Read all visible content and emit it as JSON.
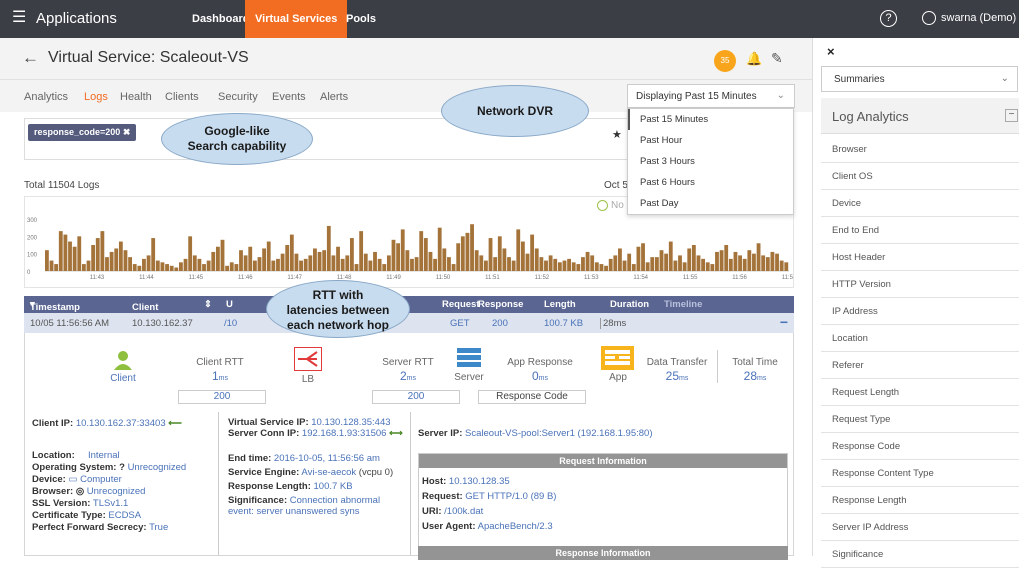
{
  "topbar": {
    "menu_icon": "hamburger-icon",
    "app_title": "Applications",
    "tabs": [
      "Dashboard",
      "Virtual Services",
      "Pools"
    ],
    "active_tab": "Virtual Services",
    "help": "?",
    "user": "swarna (Demo)"
  },
  "header": {
    "back": "←",
    "title": "Virtual Service: Scaleout-VS",
    "badge": "35"
  },
  "tabs": [
    "Analytics",
    "Logs",
    "Health",
    "Clients",
    "Security",
    "Events",
    "Alerts"
  ],
  "active_tab": "Logs",
  "search": {
    "chip": "response_code=200"
  },
  "time": {
    "selected": "Displaying Past 15 Minutes",
    "options": [
      "Past 15 Minutes",
      "Past Hour",
      "Past 3 Hours",
      "Past 6 Hours",
      "Past Day"
    ]
  },
  "stats": {
    "total": "Total 11504 Logs",
    "date": "Oct 5",
    "no_label": "No"
  },
  "chart_data": {
    "type": "bar",
    "y_ticks": [
      "300",
      "200",
      "100",
      "0"
    ],
    "x_ticks": [
      "11:43",
      "11:44",
      "11:45",
      "11:46",
      "11:47",
      "11:48",
      "11:49",
      "11:50",
      "11:51",
      "11:52",
      "11:53",
      "11:54",
      "11:55",
      "11:56",
      "11:57"
    ],
    "ylim": [
      0,
      300
    ],
    "values": [
      120,
      60,
      40,
      230,
      210,
      170,
      140,
      200,
      40,
      60,
      150,
      190,
      230,
      80,
      110,
      130,
      170,
      120,
      80,
      40,
      30,
      70,
      90,
      190,
      60,
      50,
      40,
      30,
      20,
      50,
      70,
      200,
      90,
      70,
      40,
      60,
      110,
      140,
      180,
      30,
      50,
      40,
      120,
      90,
      140,
      60,
      80,
      130,
      170,
      60,
      70,
      100,
      150,
      210,
      100,
      60,
      70,
      90,
      130,
      110,
      120,
      260,
      90,
      140,
      70,
      90,
      190,
      40,
      230,
      100,
      60,
      110,
      70,
      40,
      90,
      180,
      160,
      240,
      120,
      70,
      80,
      230,
      190,
      110,
      70,
      250,
      130,
      80,
      40,
      160,
      200,
      220,
      270,
      120,
      90,
      60,
      190,
      80,
      200,
      130,
      80,
      60,
      240,
      170,
      100,
      210,
      130,
      80,
      60,
      90,
      70,
      50,
      60,
      70,
      50,
      40,
      80,
      110,
      90,
      50,
      40,
      30,
      70,
      90,
      130,
      60,
      100,
      40,
      140,
      160,
      50,
      80,
      80,
      120,
      100,
      170,
      60,
      90,
      50,
      130,
      150,
      90,
      70,
      50,
      40,
      110,
      120,
      150,
      70,
      110,
      90,
      70,
      120,
      100,
      160,
      90,
      80,
      110,
      100,
      60,
      50
    ]
  },
  "table": {
    "headers": [
      "Timestamp",
      "Client IP",
      "U",
      "Request",
      "Response",
      "Length",
      "Duration",
      "Timeline"
    ],
    "row": {
      "timestamp": "10/05 11:56:56 AM",
      "client_ip": "10.130.162.37",
      "uri": "/10",
      "request": "GET",
      "response": "200",
      "length": "100.7 KB",
      "duration": "28ms"
    }
  },
  "flow": {
    "client": "Client",
    "client_rtt_label": "Client RTT",
    "client_rtt": "1",
    "lb": "LB",
    "server_rtt_label": "Server RTT",
    "server_rtt": "2",
    "server": "Server",
    "app_resp_label": "App Response",
    "app_resp": "0",
    "app": "App",
    "data_transfer_label": "Data Transfer",
    "data_transfer": "25",
    "total_time_label": "Total Time",
    "total_time": "28",
    "ms": "ms",
    "code1": "200",
    "code2": "200",
    "resp_code_label": "Response Code"
  },
  "details": {
    "client_ip_label": "Client IP:",
    "client_ip": "10.130.162.37:33403",
    "vs_ip_label": "Virtual Service IP:",
    "vs_ip": "10.130.128.35:443",
    "sc_ip_label": "Server Conn IP:",
    "sc_ip": "192.168.1.93:31506",
    "server_ip_label": "Server IP:",
    "server_ip": "Scaleout-VS-pool:Server1 (192.168.1.95:80)",
    "location_label": "Location:",
    "location": "Internal",
    "os_label": "Operating System:",
    "os": "Unrecognized",
    "device_label": "Device:",
    "device": "Computer",
    "browser_label": "Browser:",
    "browser": "Unrecognized",
    "ssl_label": "SSL Version:",
    "ssl": "TLSv1.1",
    "cert_label": "Certificate Type:",
    "cert": "ECDSA",
    "pfs_label": "Perfect Forward Secrecy:",
    "pfs": "True",
    "end_time_label": "End time:",
    "end_time": "2016-10-05, 11:56:56 am",
    "se_label": "Service Engine:",
    "se": "Avi-se-aecok",
    "se_note": "(vcpu 0)",
    "resp_len_label": "Response Length:",
    "resp_len": "100.7 KB",
    "sig_label": "Significance:",
    "sig1": "Connection abnormal",
    "sig2": "event: server unanswered syns"
  },
  "request_info": {
    "title": "Request Information",
    "host_label": "Host:",
    "host": "10.130.128.35",
    "request_label": "Request:",
    "request": "GET HTTP/1.0 (89 B)",
    "uri_label": "URI:",
    "uri": "/100k.dat",
    "ua_label": "User Agent:",
    "ua": "ApacheBench/2.3"
  },
  "response_info": {
    "title": "Response Information"
  },
  "callouts": {
    "dvr": "Network DVR",
    "search1": "Google-like",
    "search2": "Search capability",
    "rtt1": "RTT with",
    "rtt2": "latencies between",
    "rtt3": "each network hop"
  },
  "right_panel": {
    "close": "×",
    "summaries": "Summaries",
    "heading": "Log Analytics",
    "collapse": "−",
    "items": [
      "Browser",
      "Client OS",
      "Device",
      "End to End",
      "Host Header",
      "HTTP Version",
      "IP Address",
      "Location",
      "Referer",
      "Request Length",
      "Request Type",
      "Response Code",
      "Response Content Type",
      "Response Length",
      "Server IP Address",
      "Significance"
    ]
  },
  "colors": {
    "accent": "#f26d21",
    "topbar": "#3b3e45",
    "table_header": "#5a6592",
    "bar": "#a4733a",
    "link": "#4a72b8"
  }
}
